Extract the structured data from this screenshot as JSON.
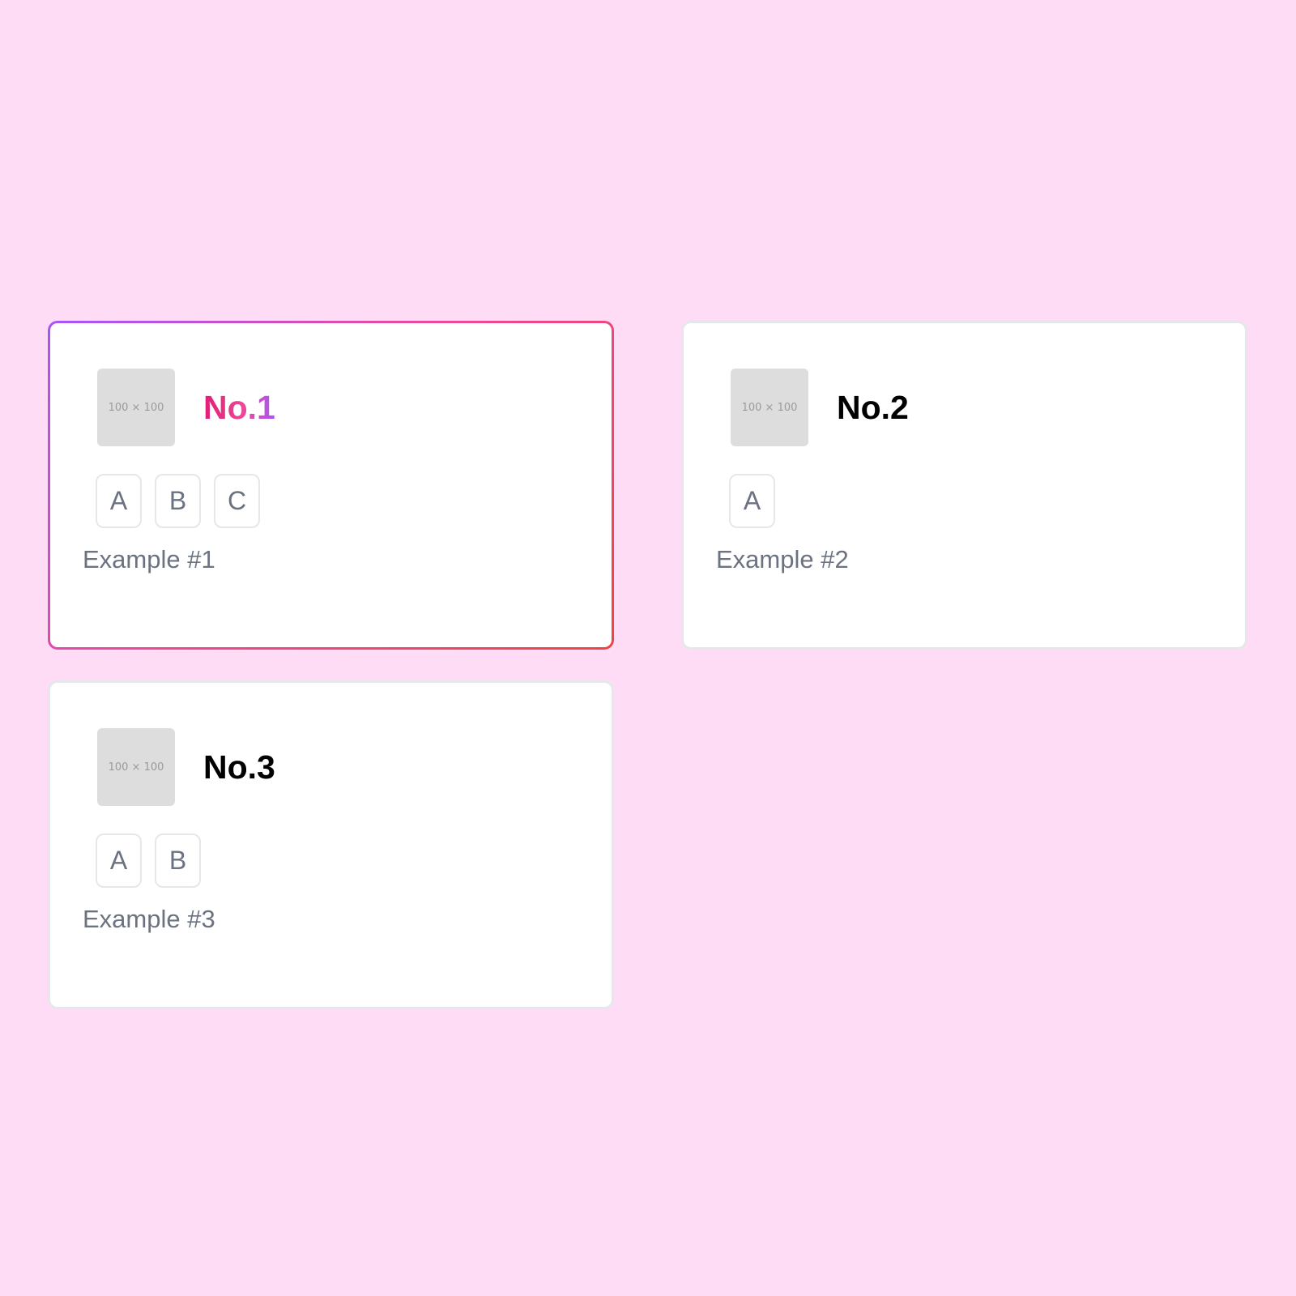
{
  "colors": {
    "page_background": "#fedcf6",
    "card_background": "#ffffff",
    "card_border": "#e5e7eb",
    "selected_border_gradient": [
      "#a855f7",
      "#ec4899",
      "#ef4444"
    ],
    "selected_title_gradient": [
      "#e11d74",
      "#ec4899",
      "#a855f7"
    ],
    "muted_text": "#6b7280",
    "placeholder_bg": "#dddddd"
  },
  "cards": [
    {
      "title": "No.1",
      "thumbnail_text": "100 × 100",
      "tags": [
        "A",
        "B",
        "C"
      ],
      "description": "Example #1",
      "selected": true
    },
    {
      "title": "No.2",
      "thumbnail_text": "100 × 100",
      "tags": [
        "A"
      ],
      "description": "Example #2",
      "selected": false
    },
    {
      "title": "No.3",
      "thumbnail_text": "100 × 100",
      "tags": [
        "A",
        "B"
      ],
      "description": "Example #3",
      "selected": false
    }
  ]
}
